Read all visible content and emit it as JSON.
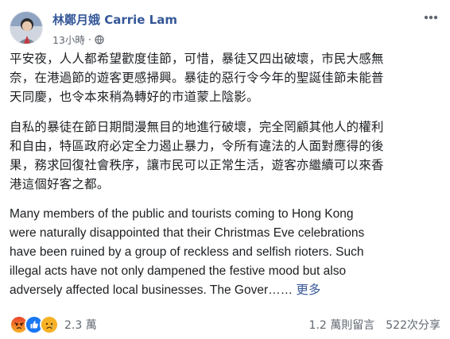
{
  "post": {
    "author": "林鄭月娥 Carrie Lam",
    "time": "13小時",
    "separator": "·",
    "visibility_icon": "globe-icon",
    "avatar_icon": "profile-photo",
    "options_icon": "more-horizontal-icon"
  },
  "body": {
    "zh_paragraphs": [
      {
        "lines": [
          "平安夜，人人都希望歡度佳節，可惜，暴徒又四出破壞，市民大感無",
          "奈，在港過節的遊客更感掃興。暴徒的惡行令今年的聖誕佳節未能普",
          "天同慶，也令本來稍為轉好的市道蒙上陰影。"
        ]
      },
      {
        "lines": [
          "自私的暴徒在節日期間漫無目的地進行破壞，完全罔顧其他人的權利",
          "和自由，特區政府必定全力遏止暴力，令所有違法的人面對應得的後",
          "果，務求回復社會秩序，讓市民可以正常生活，遊客亦繼續可以來香",
          "港這個好客之都。"
        ]
      }
    ],
    "en_lines": [
      "Many members of the public and tourists coming to Hong Kong",
      "were naturally disappointed that their Christmas Eve celebrations",
      "have been ruined by a group of reckless and selfish rioters. Such",
      "illegal acts have not only dampened the festive mood but also",
      "adversely affected local businesses. The Gover……"
    ],
    "see_more": "更多"
  },
  "footer": {
    "reaction_icons": [
      "angry-icon",
      "like-icon",
      "sad-icon"
    ],
    "reaction_count": "2.3 萬",
    "comments": "1.2 萬則留言",
    "shares": "522次分享"
  },
  "colors": {
    "author": "#365899",
    "meta": "#616770",
    "link": "#385898",
    "angry": "#f0641e",
    "like": "#1877f2",
    "sad": "#f7b125"
  }
}
